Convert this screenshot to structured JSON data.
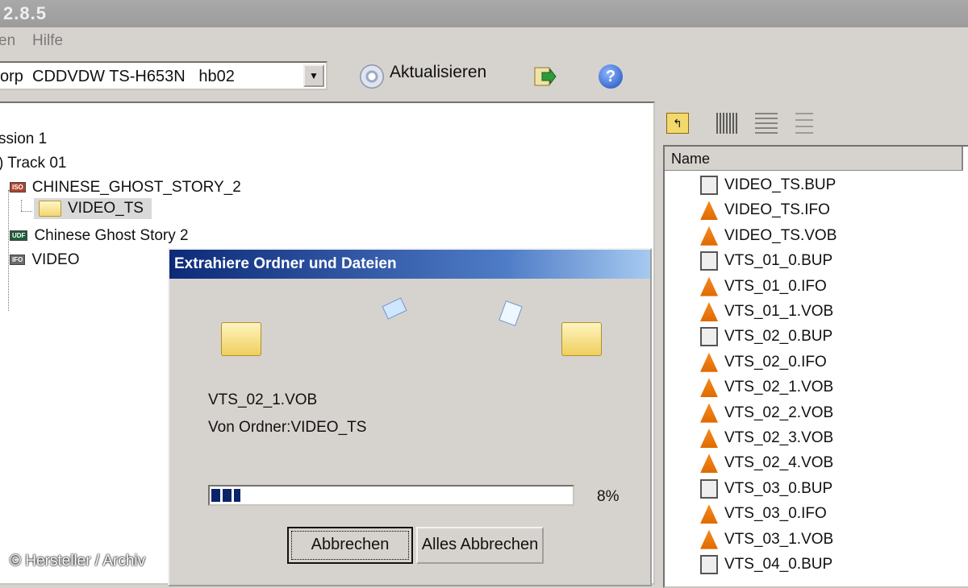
{
  "window": {
    "title": "2.8.5"
  },
  "menu": {
    "items": [
      "en",
      "Hilfe"
    ]
  },
  "toolbar": {
    "drive": "orp  CDDVDW TS-H653N   hb02",
    "refresh_label": "Aktualisieren"
  },
  "tree": {
    "session": "ssion 1",
    "track": ") Track 01",
    "iso_name": "CHINESE_GHOST_STORY_2",
    "folder": "VIDEO_TS",
    "udf_name": "Chinese Ghost Story 2",
    "ifo_name": "VIDEO",
    "tags": {
      "iso": "ISO",
      "udf": "UDF",
      "ifo": "IFO"
    }
  },
  "file_list": {
    "column": "Name",
    "files": [
      {
        "name": "VIDEO_TS.BUP",
        "icon": "bup-file-icon"
      },
      {
        "name": "VIDEO_TS.IFO",
        "icon": "vlc-file-icon"
      },
      {
        "name": "VIDEO_TS.VOB",
        "icon": "vlc-file-icon"
      },
      {
        "name": "VTS_01_0.BUP",
        "icon": "bup-file-icon"
      },
      {
        "name": "VTS_01_0.IFO",
        "icon": "vlc-file-icon"
      },
      {
        "name": "VTS_01_1.VOB",
        "icon": "vlc-file-icon"
      },
      {
        "name": "VTS_02_0.BUP",
        "icon": "bup-file-icon"
      },
      {
        "name": "VTS_02_0.IFO",
        "icon": "vlc-file-icon"
      },
      {
        "name": "VTS_02_1.VOB",
        "icon": "vlc-file-icon"
      },
      {
        "name": "VTS_02_2.VOB",
        "icon": "vlc-file-icon"
      },
      {
        "name": "VTS_02_3.VOB",
        "icon": "vlc-file-icon"
      },
      {
        "name": "VTS_02_4.VOB",
        "icon": "vlc-file-icon"
      },
      {
        "name": "VTS_03_0.BUP",
        "icon": "bup-file-icon"
      },
      {
        "name": "VTS_03_0.IFO",
        "icon": "vlc-file-icon"
      },
      {
        "name": "VTS_03_1.VOB",
        "icon": "vlc-file-icon"
      },
      {
        "name": "VTS_04_0.BUP",
        "icon": "bup-file-icon"
      }
    ]
  },
  "dialog": {
    "title": "Extrahiere Ordner und Dateien",
    "current_file": "VTS_02_1.VOB",
    "from_folder": "Von Ordner:VIDEO_TS",
    "progress": 0.08,
    "percent_label": "8%",
    "cancel_label": "Abbrechen",
    "cancel_all_label": "Alles Abbrechen"
  },
  "watermark": "© Hersteller / Archiv",
  "colors": {
    "dialog_title_start": "#0c2a78",
    "dialog_title_end": "#a6caf0",
    "progress_fill": "#0a246a"
  }
}
